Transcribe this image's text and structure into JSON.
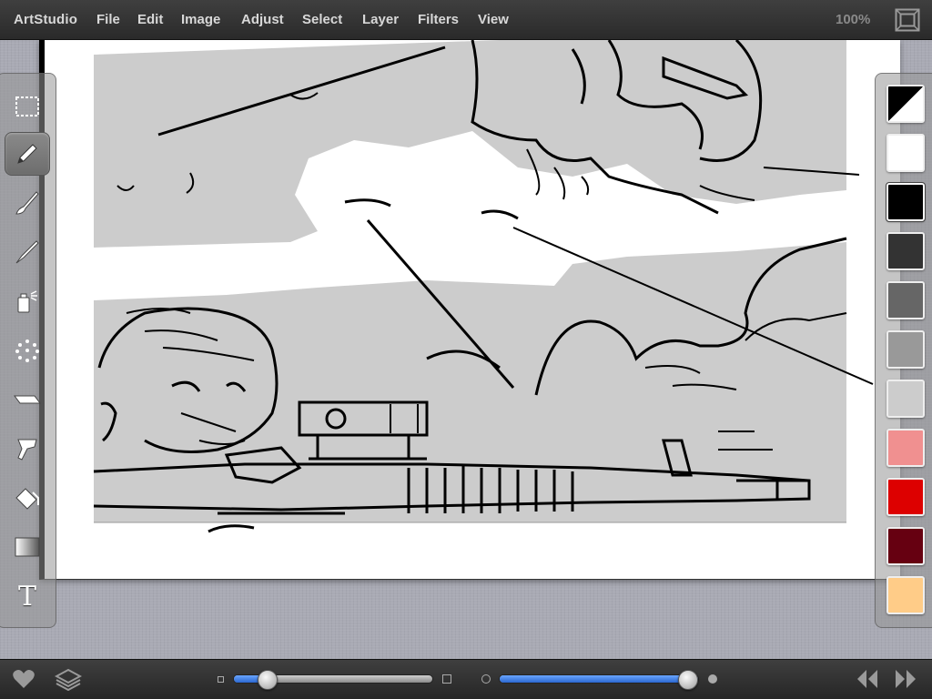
{
  "menubar": {
    "app_name": "ArtStudio",
    "items": [
      "File",
      "Edit",
      "Image",
      "Adjust",
      "Select",
      "Layer",
      "Filters",
      "View"
    ],
    "zoom": "100%"
  },
  "tools": [
    {
      "name": "rectangle-select",
      "icon": "marquee-icon"
    },
    {
      "name": "pencil",
      "icon": "pencil-icon",
      "active": true
    },
    {
      "name": "brush",
      "icon": "brush-icon"
    },
    {
      "name": "paintbrush",
      "icon": "paintbrush-icon"
    },
    {
      "name": "spray",
      "icon": "spray-can-icon"
    },
    {
      "name": "scatter",
      "icon": "scatter-dots-icon"
    },
    {
      "name": "eraser",
      "icon": "eraser-icon"
    },
    {
      "name": "smudge",
      "icon": "smudge-icon"
    },
    {
      "name": "fill",
      "icon": "paint-bucket-icon"
    },
    {
      "name": "gradient",
      "icon": "gradient-icon"
    },
    {
      "name": "text",
      "icon": "text-icon",
      "glyph": "T"
    }
  ],
  "palette": {
    "swatches": [
      {
        "name": "black-white",
        "color": "split"
      },
      {
        "name": "white",
        "color": "#ffffff"
      },
      {
        "name": "black",
        "color": "#000000",
        "selected": true
      },
      {
        "name": "dark-gray",
        "color": "#333333"
      },
      {
        "name": "gray",
        "color": "#666666"
      },
      {
        "name": "mid-gray",
        "color": "#999999"
      },
      {
        "name": "light-gray",
        "color": "#cccccc"
      },
      {
        "name": "pink",
        "color": "#f09090"
      },
      {
        "name": "red",
        "color": "#dd0000"
      },
      {
        "name": "dark-red",
        "color": "#660011"
      },
      {
        "name": "peach",
        "color": "#ffcc88"
      }
    ]
  },
  "bottombar": {
    "size_slider": {
      "value": 0.14
    },
    "opacity_slider": {
      "value": 1.0
    }
  },
  "colors": {
    "bar_bg": "#2f2f2f",
    "canvas_gray": "#cccccc",
    "slider_blue": "#3b7fe0"
  }
}
